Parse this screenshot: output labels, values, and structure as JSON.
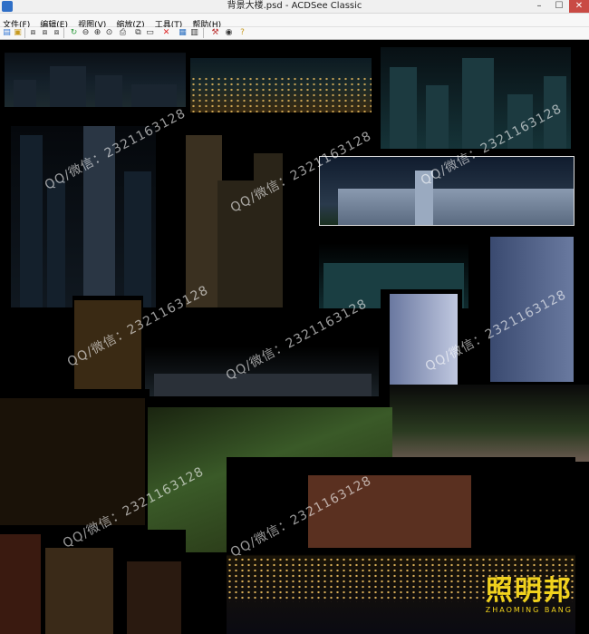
{
  "window": {
    "title": "背景大楼.psd - ACDSee Classic",
    "minimize_icon": "minimize-icon",
    "maximize_icon": "maximize-icon",
    "close_icon": "close-icon"
  },
  "menu": {
    "items": [
      "文件(F)",
      "编辑(E)",
      "视图(V)",
      "缩放(Z)",
      "工具(T)",
      "帮助(H)"
    ]
  },
  "toolbar": {
    "icons": [
      "open-icon",
      "save-icon",
      "first-icon",
      "prev-icon",
      "next-icon",
      "last-icon",
      "rotate-icon",
      "zoom-out-icon",
      "zoom-in-icon",
      "zoom-fit-icon",
      "print-icon",
      "copy-icon",
      "paste-icon",
      "delete-icon",
      "slideshow-icon",
      "properties-icon",
      "tools-icon",
      "eye-icon",
      "help-icon"
    ]
  },
  "watermarks": [
    "QQ/微信：2321163128",
    "QQ/微信：2321163128",
    "QQ/微信：2321163128",
    "QQ/微信：2321163128",
    "QQ/微信：2321163128",
    "QQ/微信：2321163128",
    "QQ/微信：2321163128",
    "QQ/微信：2321163128"
  ],
  "logo": {
    "name": "照明邦",
    "subtitle": "ZHAOMING BANG",
    "color": "#f1d21d"
  }
}
